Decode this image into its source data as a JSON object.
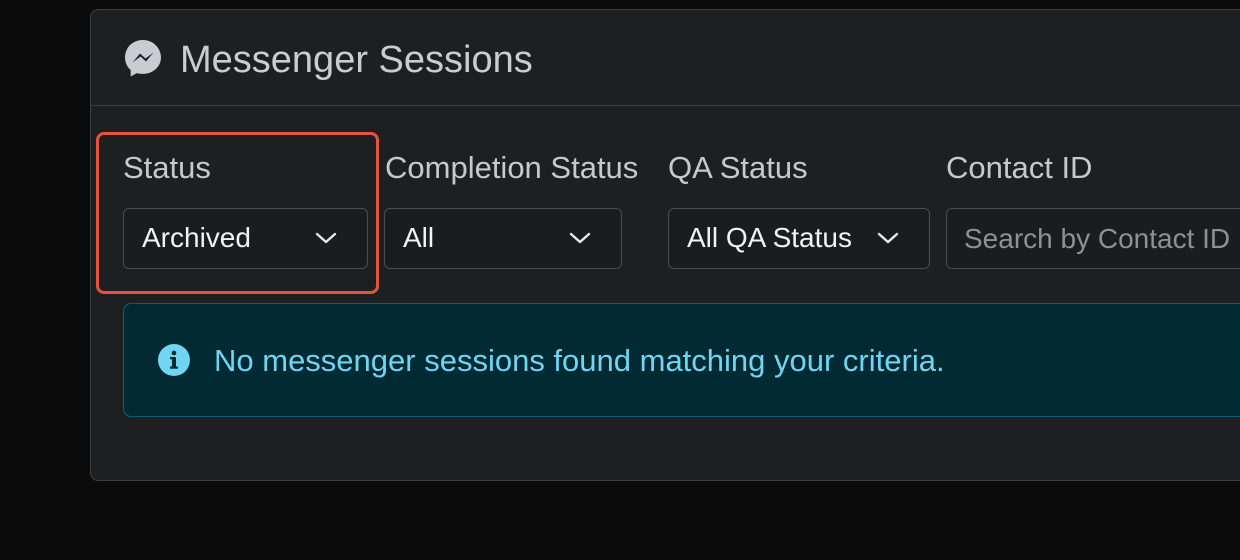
{
  "header": {
    "title": "Messenger Sessions",
    "icon": "messenger-icon"
  },
  "filters": {
    "status": {
      "label": "Status",
      "value": "Archived",
      "icon": "chevron-down-icon"
    },
    "completion_status": {
      "label": "Completion Status",
      "value": "All",
      "icon": "chevron-down-icon"
    },
    "qa_status": {
      "label": "QA Status",
      "value": "All QA Status",
      "icon": "chevron-down-icon"
    },
    "contact_id": {
      "label": "Contact ID",
      "value": "",
      "placeholder": "Search by Contact ID"
    }
  },
  "alert": {
    "icon": "info-icon",
    "message": "No messenger sessions found matching your criteria."
  },
  "colors": {
    "page_bg": "#0b0b0b",
    "card_bg": "#1e1f20",
    "highlight": "#e5533d",
    "alert_bg": "#022a33",
    "alert_text": "#6fd5f2"
  }
}
